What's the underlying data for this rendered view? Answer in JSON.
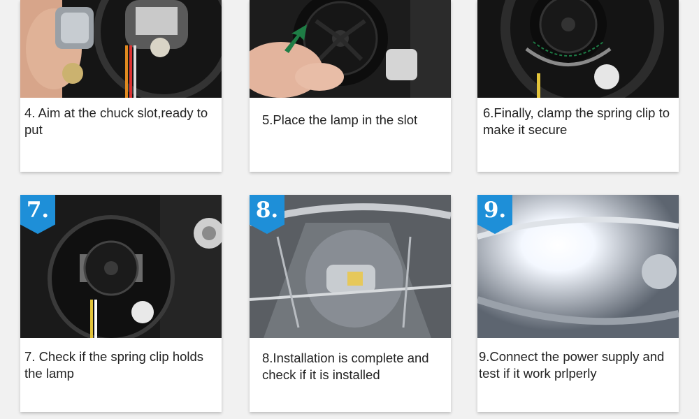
{
  "steps": [
    {
      "caption": "4. Aim at the chuck slot,ready to put"
    },
    {
      "caption": "5.Place the lamp in the slot"
    },
    {
      "caption": "6.Finally, clamp the spring clip to make it secure"
    },
    {
      "badge": "7.",
      "caption": "7. Check if the spring clip holds the lamp"
    },
    {
      "badge": "8.",
      "caption": "8.Installation is complete and check if it is installed"
    },
    {
      "badge": "9.",
      "caption": "9.Connect the power supply and test if it work prlperly"
    }
  ],
  "colors": {
    "badge": "#1e8fd8",
    "card": "#ffffff",
    "background": "#f1f1f1"
  }
}
